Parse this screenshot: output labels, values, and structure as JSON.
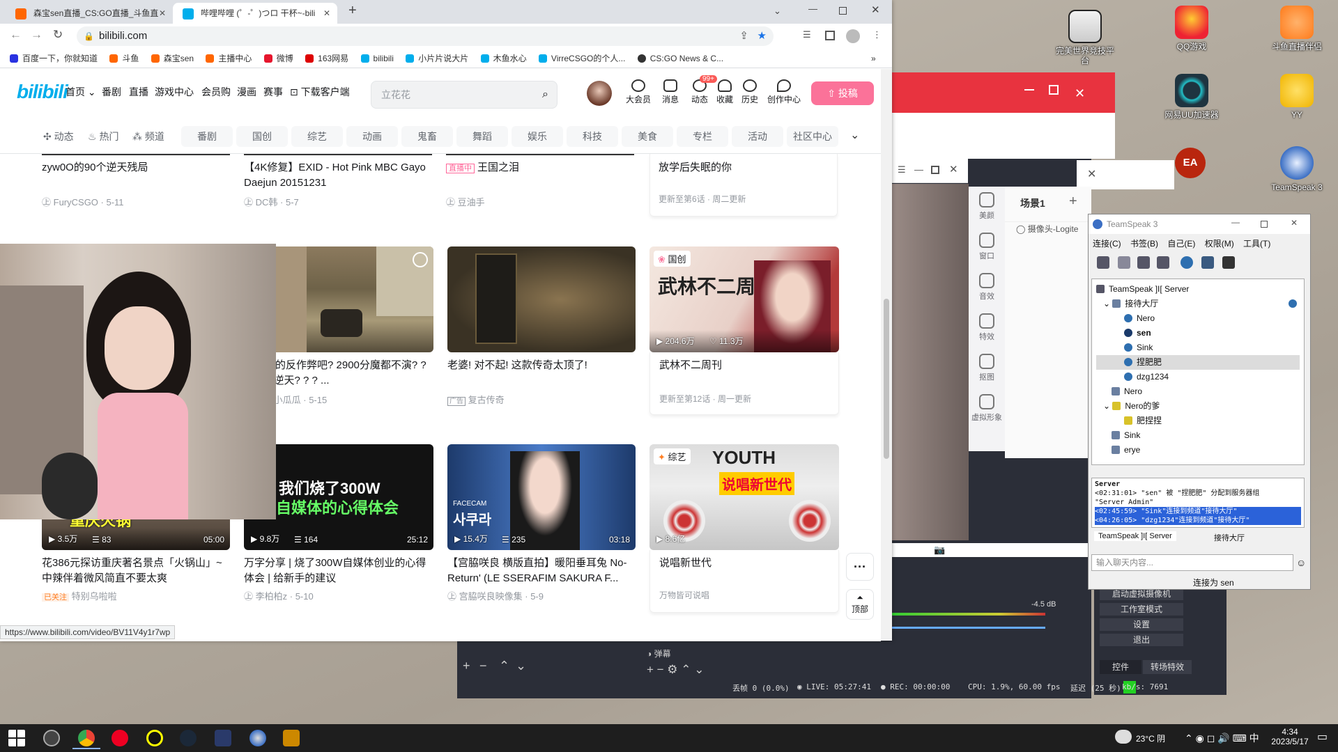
{
  "browser": {
    "tabs": [
      {
        "title": "森宝sen直播_CS:GO直播_斗鱼直"
      },
      {
        "title": "哔哩哔哩 (゜-゜)つロ 干杯~-bili"
      }
    ],
    "url": "bilibili.com",
    "bookmarks": [
      "百度一下，你就知道",
      "斗鱼",
      "森宝sen",
      "主播中心",
      "微博",
      "163网易",
      "bilibili",
      "小片片说大片",
      "木鱼水心",
      "VirreCSGO的个人...",
      "CS:GO News & C..."
    ],
    "status_url": "https://www.bilibili.com/video/BV11V4y1r7wp"
  },
  "bili": {
    "logo": "bilibili",
    "nav": [
      "首页",
      "番剧",
      "直播",
      "游戏中心",
      "会员购",
      "漫画",
      "赛事",
      "下载客户端"
    ],
    "search_placeholder": "立花花",
    "header_icons": [
      "大会员",
      "消息",
      "动态",
      "收藏",
      "历史",
      "创作中心"
    ],
    "badge": "99+",
    "upload": "投稿",
    "channel_left": [
      "动态",
      "热门",
      "频道"
    ],
    "channels": [
      "番剧",
      "国创",
      "综艺",
      "动画",
      "鬼畜",
      "舞蹈",
      "娱乐",
      "科技",
      "美食",
      "专栏",
      "活动",
      "社区中心"
    ],
    "row1": [
      {
        "title": "zyw0O的90个逆天残局",
        "sub": "FuryCSGO · 5-11"
      },
      {
        "title": "【4K修复】EXID - Hot Pink MBC Gayo Daejun 20151231",
        "sub": "DC韩 · 5-7"
      },
      {
        "tag": "直播中",
        "title": "王国之泪",
        "sub": "豆油手"
      },
      {
        "title": "放学后失眠的你",
        "sub": "更新至第6话 · 周二更新"
      }
    ],
    "row2": [
      {
        "title": "看看你的反作弊吧? 2900分魔都不演? ? ? 全程逆天? ? ? ...",
        "sub": "厨师小瓜瓜 · 5-15"
      },
      {
        "title": "老婆! 对不起! 这款传奇太顶了!",
        "ad": "广告",
        "sub": "复古传奇"
      },
      {
        "tag": "国创",
        "title": "武林不二周刊",
        "views": "204.6万",
        "likes": "11.3万",
        "sub": "更新至第12话 · 周一更新",
        "cover_text": "武林不二周刊"
      }
    ],
    "row3": [
      {
        "title": "花386元探访重庆著名景点「火锅山」~中辣伴着微风简直不要太爽",
        "followed": "已关注",
        "up": "特别乌啦啦",
        "views": "3.5万",
        "danmaku": "83",
        "dur": "05:00",
        "cover_text": "重庆火锅"
      },
      {
        "title": "万字分享 | 烧了300W自媒体创业的心得体会 | 给新手的建议",
        "sub": "李柏柏z · 5-10",
        "views": "9.8万",
        "danmaku": "164",
        "dur": "25:12",
        "cover_l1": "我们烧了300W",
        "cover_l2": "自媒体的心得体会"
      },
      {
        "title": "【宫脇咲良 横版直拍】暖阳垂耳兔 No-Return' (LE SSERAFIM SAKURA F...",
        "sub": "宫脇咲良映像集 · 5-9",
        "views": "15.4万",
        "danmaku": "235",
        "dur": "03:18",
        "cover_text": "사쿠라",
        "cam": "FACECAM"
      },
      {
        "tag": "综艺",
        "title": "说唱新世代",
        "sub": "万物皆可说唱",
        "views": "8.6亿",
        "cover_text": "说唱新世代",
        "cover_top": "YOUTH"
      }
    ],
    "more": "···",
    "top": "顶部"
  },
  "desktop_icons": [
    {
      "name": "完美世界竞技平台"
    },
    {
      "name": "QQ游戏"
    },
    {
      "name": "斗鱼直播伴侣"
    },
    {
      "name": "网易UU加速器"
    },
    {
      "name": "YY"
    },
    {
      "name": "TeamSpeak 3"
    }
  ],
  "obs": {
    "scene_title": "场景1",
    "source": "摄像头-Logite",
    "side": [
      "美颜",
      "窗口",
      "音效",
      "特效",
      "抠图",
      "虚拟形象"
    ],
    "menu": [
      "启动虚拟摄像机",
      "工作室模式",
      "设置",
      "退出"
    ],
    "tabs": [
      "控件",
      "转场特效"
    ],
    "db": "-4.5 dB",
    "mixer_src": [
      "弹幕"
    ],
    "status": {
      "drop": "丢帧 0 (0.0%)",
      "live": "LIVE: 05:27:41",
      "rec": "REC: 00:00:00",
      "cpu": "CPU: 1.9%, 60.00 fps",
      "delay": "延迟 (25 秒)",
      "kbs": "kb/s: 7691"
    }
  },
  "ts": {
    "title": "TeamSpeak 3",
    "menu": [
      "连接(C)",
      "书签(B)",
      "自己(E)",
      "权限(M)",
      "工具(T)"
    ],
    "server": "TeamSpeak ]I[ Server",
    "tree": [
      {
        "label": "接待大厅",
        "type": "channel",
        "depth": 1
      },
      {
        "label": "Nero",
        "type": "user",
        "depth": 2
      },
      {
        "label": "sen",
        "type": "user",
        "depth": 2,
        "bold": true
      },
      {
        "label": "Sink",
        "type": "user",
        "depth": 2
      },
      {
        "label": "捏肥肥",
        "type": "user",
        "depth": 2,
        "selected": true
      },
      {
        "label": "dzg1234",
        "type": "user",
        "depth": 2
      },
      {
        "label": "Nero",
        "type": "channel",
        "depth": 1
      },
      {
        "label": "Nero的爹",
        "type": "channel",
        "depth": 1
      },
      {
        "label": "肥捏捏",
        "type": "channel",
        "depth": 2
      },
      {
        "label": "Sink",
        "type": "channel",
        "depth": 1
      },
      {
        "label": "erye",
        "type": "channel",
        "depth": 1
      }
    ],
    "log_title": "Server",
    "log": [
      "<02:31:01> \"sen\" 被 \"捏肥肥\" 分配到服务器组",
      "\"Server Admin\"",
      "<02:45:59> \"Sink\"连接到频道\"接待大厅\"",
      "<04:26:05> \"dzg1234\"连接到频道\"接待大厅\""
    ],
    "tabs": [
      "TeamSpeak ]I[ Server",
      "接待大厅"
    ],
    "chat_placeholder": "输入聊天内容...",
    "connected": "连接为 sen"
  },
  "taskbar": {
    "weather": "23°C 阴",
    "time": "4:34",
    "date": "2023/5/17"
  }
}
